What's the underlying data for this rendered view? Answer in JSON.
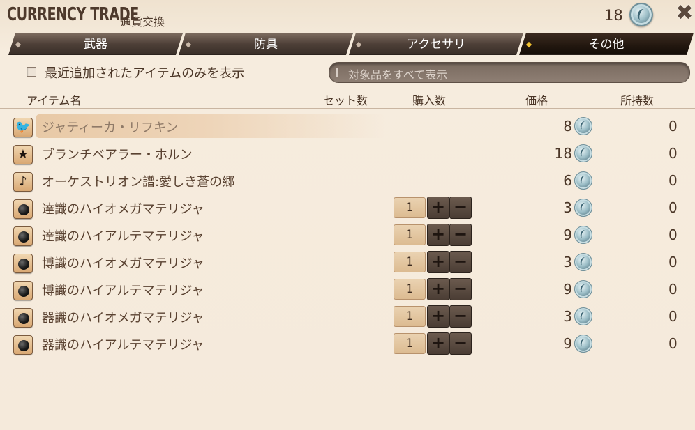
{
  "window": {
    "title": "CURRENCY TRADE",
    "subtitle": "通貨交換",
    "currency_count": "18"
  },
  "tabs": [
    {
      "label": "武器",
      "active": false
    },
    {
      "label": "防具",
      "active": false
    },
    {
      "label": "アクセサリ",
      "active": false
    },
    {
      "label": "その他",
      "active": true
    }
  ],
  "filter": {
    "checkbox_label": "最近追加されたアイテムのみを表示",
    "search_placeholder": "対象品をすべて表示"
  },
  "columns": {
    "name": "アイテム名",
    "set": "セット数",
    "buy": "購入数",
    "price": "価格",
    "owned": "所持数"
  },
  "items": [
    {
      "name": "ジャティーカ・リフキン",
      "icon": "bird-icon",
      "price": "8",
      "owned": "0",
      "quantity": null,
      "selected": true
    },
    {
      "name": "ブランチベアラー・ホルン",
      "icon": "star-icon",
      "price": "18",
      "owned": "0",
      "quantity": null,
      "selected": false
    },
    {
      "name": "オーケストリオン譜:愛しき蒼の郷",
      "icon": "music-note-icon",
      "price": "6",
      "owned": "0",
      "quantity": null,
      "selected": false
    },
    {
      "name": "達識のハイオメガマテリジャ",
      "icon": "materia-orb-icon",
      "price": "3",
      "owned": "0",
      "quantity": "1",
      "selected": false
    },
    {
      "name": "達識のハイアルテマテリジャ",
      "icon": "materia-orb-icon",
      "price": "9",
      "owned": "0",
      "quantity": "1",
      "selected": false
    },
    {
      "name": "博識のハイオメガマテリジャ",
      "icon": "materia-orb-icon",
      "price": "3",
      "owned": "0",
      "quantity": "1",
      "selected": false
    },
    {
      "name": "博識のハイアルテマテリジャ",
      "icon": "materia-orb-icon",
      "price": "9",
      "owned": "0",
      "quantity": "1",
      "selected": false
    },
    {
      "name": "器識のハイオメガマテリジャ",
      "icon": "materia-orb-icon",
      "price": "3",
      "owned": "0",
      "quantity": "1",
      "selected": false
    },
    {
      "name": "器識のハイアルテマテリジャ",
      "icon": "materia-orb-icon",
      "price": "9",
      "owned": "0",
      "quantity": "1",
      "selected": false
    }
  ],
  "stepper": {
    "plus": "+",
    "minus": "−"
  },
  "colors": {
    "background": "#f5eadb",
    "tab_active": "#22170f",
    "tab_inactive": "#4e4038",
    "accent": "#f2c230"
  }
}
